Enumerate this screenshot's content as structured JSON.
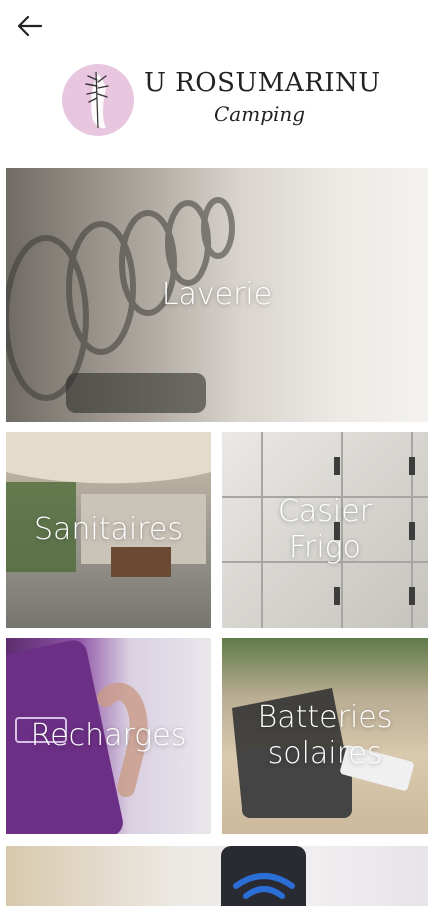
{
  "nav": {
    "back_icon": "arrow-left-icon"
  },
  "logo": {
    "title": "U ROSUMARINU",
    "subtitle": "Camping",
    "accent": "#e9c6e0"
  },
  "tiles": [
    {
      "label": "Laverie"
    },
    {
      "label": "Sanitaires"
    },
    {
      "label": "Casier\nFrigo"
    },
    {
      "label": "Recharges"
    },
    {
      "label": "Batteries\nsolaires"
    }
  ],
  "colors": {
    "background": "#ffffff",
    "label_text": "#ffffff"
  }
}
